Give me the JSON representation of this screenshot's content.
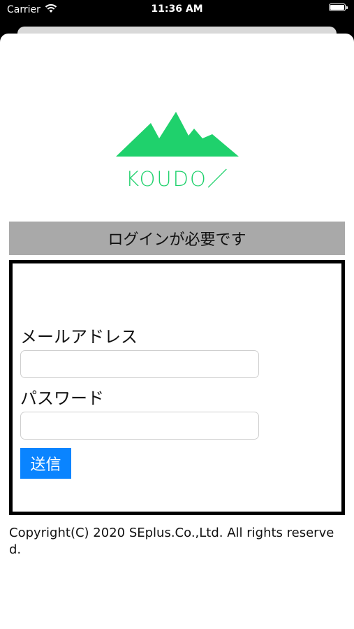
{
  "status_bar": {
    "carrier": "Carrier",
    "time": "11:36 AM"
  },
  "logo": {
    "text": "KOUDO／",
    "color": "#1fd16c"
  },
  "login": {
    "banner": "ログインが必要です",
    "email_label": "メールアドレス",
    "email_value": "",
    "password_label": "パスワード",
    "password_value": "",
    "submit_label": "送信",
    "accent": "#0a84ff"
  },
  "footer": {
    "copyright": "Copyright(C) 2020 SEplus.Co.,Ltd. All rights reserved."
  }
}
